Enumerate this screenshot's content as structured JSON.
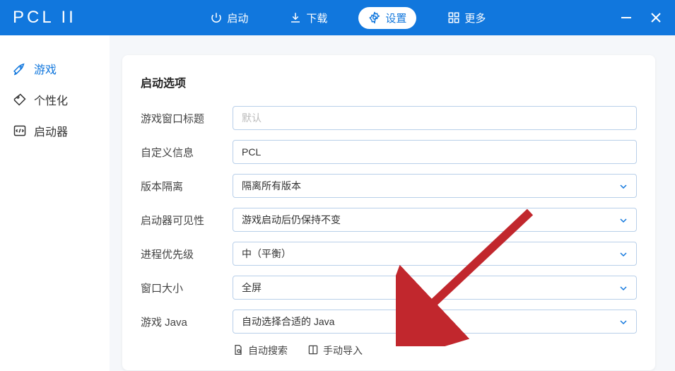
{
  "logo": "PCL II",
  "nav": {
    "launch": "启动",
    "download": "下载",
    "settings": "设置",
    "more": "更多"
  },
  "sidebar": {
    "game": "游戏",
    "personalize": "个性化",
    "launcher": "启动器"
  },
  "card": {
    "title": "启动选项",
    "rows": {
      "windowTitle": {
        "label": "游戏窗口标题",
        "placeholder": "默认"
      },
      "customInfo": {
        "label": "自定义信息",
        "value": "PCL"
      },
      "isolation": {
        "label": "版本隔离",
        "value": "隔离所有版本"
      },
      "visibility": {
        "label": "启动器可见性",
        "value": "游戏启动后仍保持不变"
      },
      "priority": {
        "label": "进程优先级",
        "value": "中（平衡）"
      },
      "windowSize": {
        "label": "窗口大小",
        "value": "全屏"
      },
      "java": {
        "label": "游戏 Java",
        "value": "自动选择合适的 Java"
      }
    },
    "actions": {
      "autoSearch": "自动搜索",
      "manualImport": "手动导入"
    }
  }
}
